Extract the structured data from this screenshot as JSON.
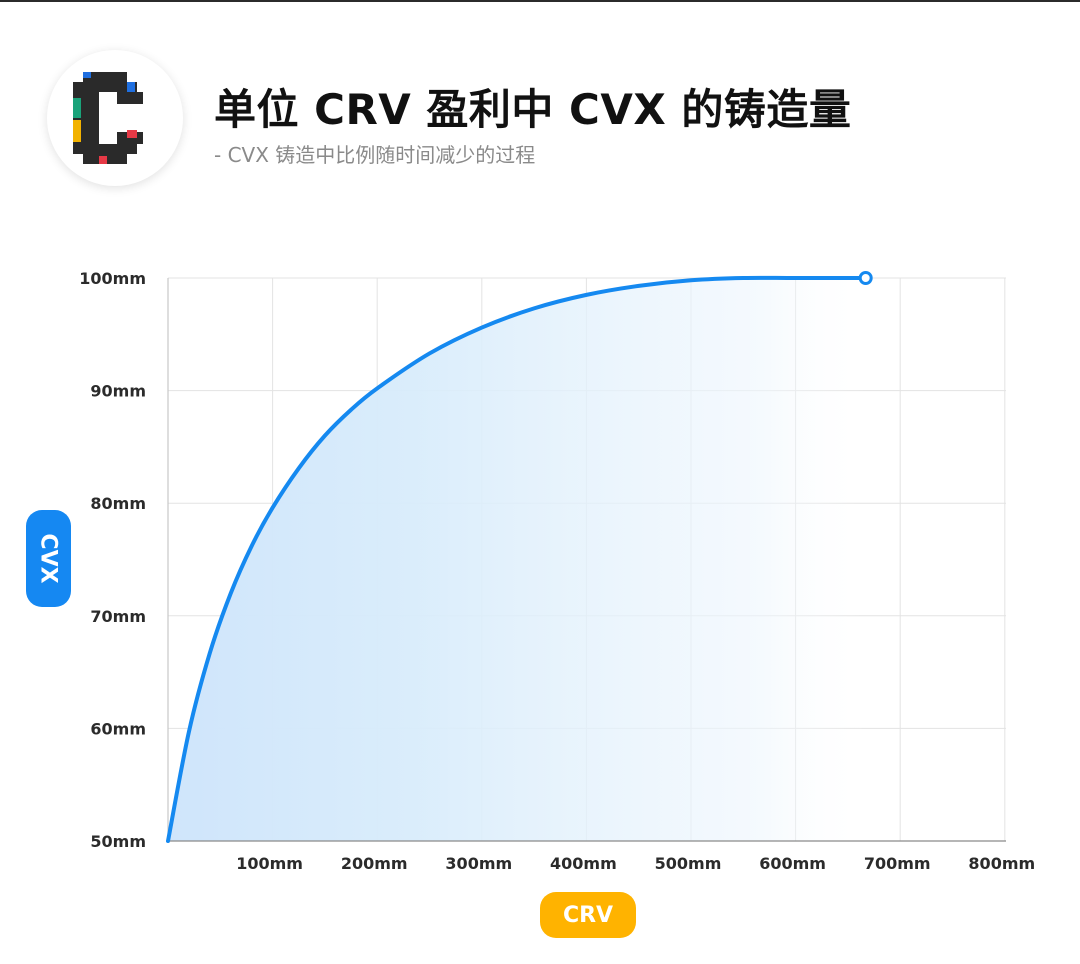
{
  "header": {
    "title": "单位 CRV 盈利中 CVX 的铸造量",
    "subtitle": "- CVX 铸造中比例随时间减少的过程"
  },
  "logo": {
    "icon": "convex-logo-icon"
  },
  "chart_data": {
    "type": "area",
    "title": "单位 CRV 盈利中 CVX 的铸造量",
    "subtitle": "- CVX 铸造中比例随时间减少的过程",
    "xlabel": "CRV",
    "ylabel": "CVX",
    "xlim": [
      0,
      800
    ],
    "ylim": [
      50,
      100
    ],
    "x_ticks": [
      "100mm",
      "200mm",
      "300mm",
      "400mm",
      "500mm",
      "600mm",
      "700mm",
      "800mm"
    ],
    "y_ticks": [
      "50mm",
      "60mm",
      "70mm",
      "80mm",
      "90mm",
      "100mm"
    ],
    "grid": true,
    "colors": {
      "line": "#1589f0",
      "fill": "#cfe5fb",
      "xlabel_bg": "#ffb300",
      "ylabel_bg": "#1588f2"
    },
    "series": [
      {
        "x": [
          0,
          20,
          40,
          60,
          80,
          100,
          125,
          150,
          175,
          200,
          250,
          300,
          350,
          400,
          450,
          500,
          550,
          600,
          667
        ],
        "y": [
          50.0,
          59.7,
          66.7,
          72.0,
          76.2,
          79.6,
          83.1,
          86.0,
          88.3,
          90.2,
          93.3,
          95.6,
          97.3,
          98.5,
          99.3,
          99.8,
          100.0,
          100.0,
          100.0
        ]
      }
    ],
    "end_marker": {
      "x": 667,
      "y": 100
    }
  }
}
